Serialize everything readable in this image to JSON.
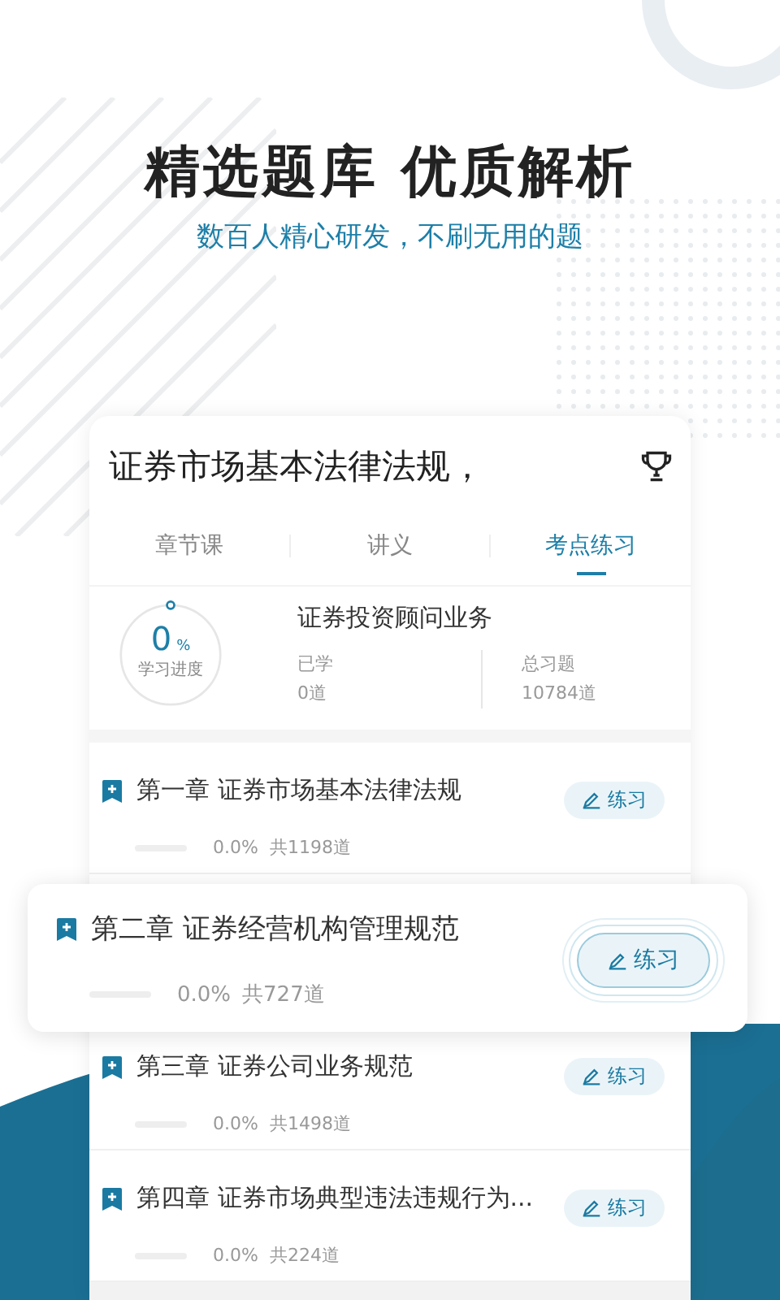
{
  "headline": "精选题库 优质解析",
  "subtitle": "数百人精心研发，不刷无用的题",
  "course": {
    "title": "证券市场基本法律法规，",
    "tabs": [
      {
        "label": "章节课",
        "selected": false
      },
      {
        "label": "讲义",
        "selected": false
      },
      {
        "label": "考点练习",
        "selected": true
      }
    ],
    "progress": {
      "value": "0",
      "unit": "%",
      "label": "学习进度",
      "level": 0
    },
    "subject": "证券投资顾问业务",
    "stats": [
      {
        "label": "已学",
        "value": "0道"
      },
      {
        "label": "总习题",
        "value": "10784道"
      }
    ],
    "chapters": [
      {
        "title": "第一章 证券市场基本法律法规",
        "percent": "0.0%",
        "count": "共1198道",
        "level": 0,
        "button": "练习",
        "highlighted": false
      },
      {
        "title": "第二章 证券经营机构管理规范",
        "percent": "0.0%",
        "count": "共727道",
        "level": 0,
        "button": "练习",
        "highlighted": true
      },
      {
        "title": "第三章 证券公司业务规范",
        "percent": "0.0%",
        "count": "共1498道",
        "level": 0,
        "button": "练习",
        "highlighted": false
      },
      {
        "title": "第四章 证券市场典型违法违规行为...",
        "percent": "0.0%",
        "count": "共224道",
        "level": 0,
        "button": "练习",
        "highlighted": false
      }
    ]
  }
}
